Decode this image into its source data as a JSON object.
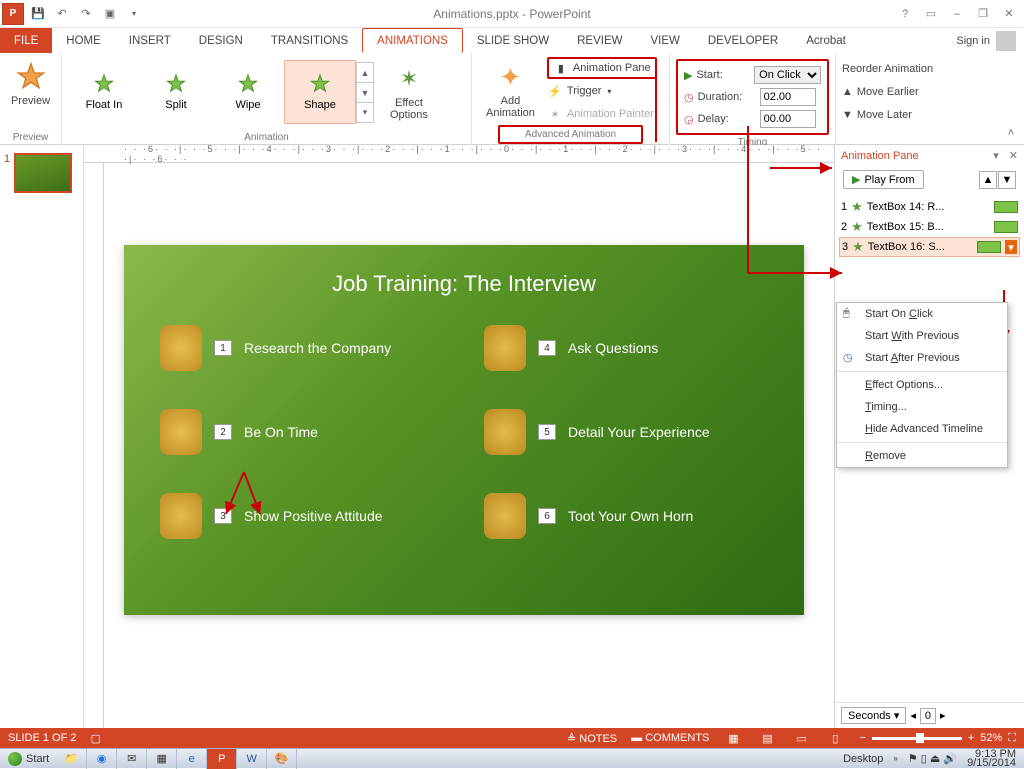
{
  "app": {
    "title": "Animations.pptx - PowerPoint"
  },
  "qat": {
    "save": "Save",
    "undo": "Undo",
    "redo": "Redo",
    "start": "Start from beginning"
  },
  "wincontrols": {
    "help": "?",
    "ribbon": "▭",
    "min": "–",
    "restore": "❐",
    "close": "✕"
  },
  "tabs": {
    "file": "FILE",
    "home": "HOME",
    "insert": "INSERT",
    "design": "DESIGN",
    "transitions": "TRANSITIONS",
    "animations": "ANIMATIONS",
    "slideshow": "SLIDE SHOW",
    "review": "REVIEW",
    "view": "VIEW",
    "developer": "DEVELOPER",
    "acrobat": "Acrobat"
  },
  "signin": "Sign in",
  "ribbon": {
    "preview": {
      "label": "Preview",
      "group": "Preview"
    },
    "gallery": {
      "group": "Animation",
      "items": [
        "Float In",
        "Split",
        "Wipe",
        "Shape"
      ],
      "selected": "Shape"
    },
    "effectOptions": "Effect\nOptions",
    "advanced": {
      "group": "Advanced Animation",
      "add": "Add\nAnimation",
      "pane": "Animation Pane",
      "trigger": "Trigger",
      "painter": "Animation Painter"
    },
    "timing": {
      "group": "Timing",
      "start_lbl": "Start:",
      "start": "On Click",
      "duration_lbl": "Duration:",
      "duration": "02.00",
      "delay_lbl": "Delay:",
      "delay": "00.00",
      "reorder": "Reorder Animation",
      "earlier": "Move Earlier",
      "later": "Move Later"
    }
  },
  "thumbs": {
    "num": "1"
  },
  "slide": {
    "title": "Job Training: The Interview",
    "left": [
      {
        "n": "1",
        "t": "Research the Company"
      },
      {
        "n": "2",
        "t": "Be On Time"
      },
      {
        "n": "3",
        "t": "Show Positive Attitude"
      }
    ],
    "right": [
      {
        "n": "4",
        "t": "Ask Questions"
      },
      {
        "n": "5",
        "t": "Detail Your Experience"
      },
      {
        "n": "6",
        "t": "Toot Your Own Horn"
      }
    ]
  },
  "animpane": {
    "title": "Animation Pane",
    "play": "Play From",
    "items": [
      {
        "n": "1",
        "t": "TextBox 14: R..."
      },
      {
        "n": "2",
        "t": "TextBox 15: B..."
      },
      {
        "n": "3",
        "t": "TextBox 16: S..."
      }
    ],
    "footer": {
      "seconds": "Seconds",
      "zero": "0"
    }
  },
  "ctx": {
    "soc": "Start On Click",
    "swp": "Start With Previous",
    "sap": "Start After Previous",
    "eo": "Effect Options...",
    "tim": "Timing...",
    "hat": "Hide Advanced Timeline",
    "rem": "Remove"
  },
  "status": {
    "slideof": "SLIDE 1 OF 2",
    "notes": "NOTES",
    "comments": "COMMENTS",
    "zoom": "52%"
  },
  "taskbar": {
    "start": "Start",
    "desktop": "Desktop",
    "time": "9:13 PM",
    "date": "9/15/2014"
  }
}
